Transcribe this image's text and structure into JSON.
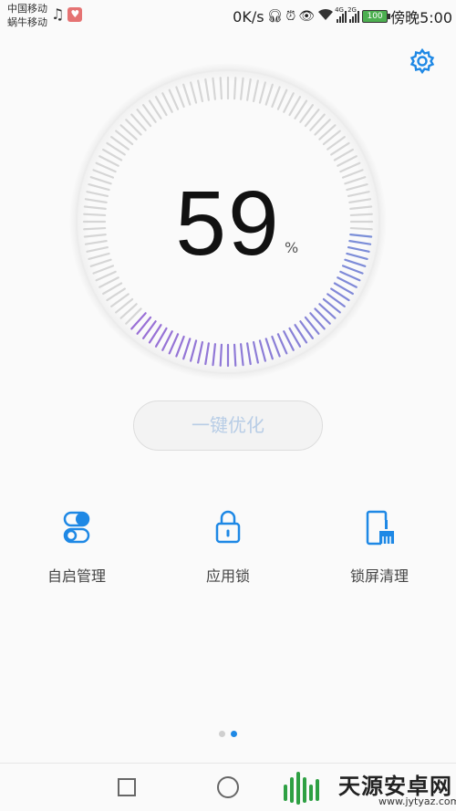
{
  "status_bar": {
    "carrier_1": "中国移动",
    "carrier_2": "蜗牛移动",
    "net_speed": "0K/s",
    "signal_1_tag": "4G",
    "signal_2_tag": "2G",
    "battery": "100",
    "time": "傍晚5:00"
  },
  "main": {
    "score_value": "59",
    "score_unit": "%",
    "progress_fraction": 0.59,
    "optimize_label": "一键优化"
  },
  "features": [
    {
      "label": "自启管理",
      "icon": "toggle-switches-icon"
    },
    {
      "label": "应用锁",
      "icon": "padlock-icon"
    },
    {
      "label": "锁屏清理",
      "icon": "phone-broom-icon"
    }
  ],
  "pager": {
    "pages": 2,
    "active": 1
  },
  "watermark": {
    "text": "天源安卓网",
    "url": "www.jytyaz.com"
  },
  "colors": {
    "accent": "#1e88e5",
    "dial_tick": "#d6d6d6",
    "dial_active_start": "#7b8fd8",
    "dial_active_end": "#9a6fd6",
    "button_text": "#b8cde6"
  }
}
